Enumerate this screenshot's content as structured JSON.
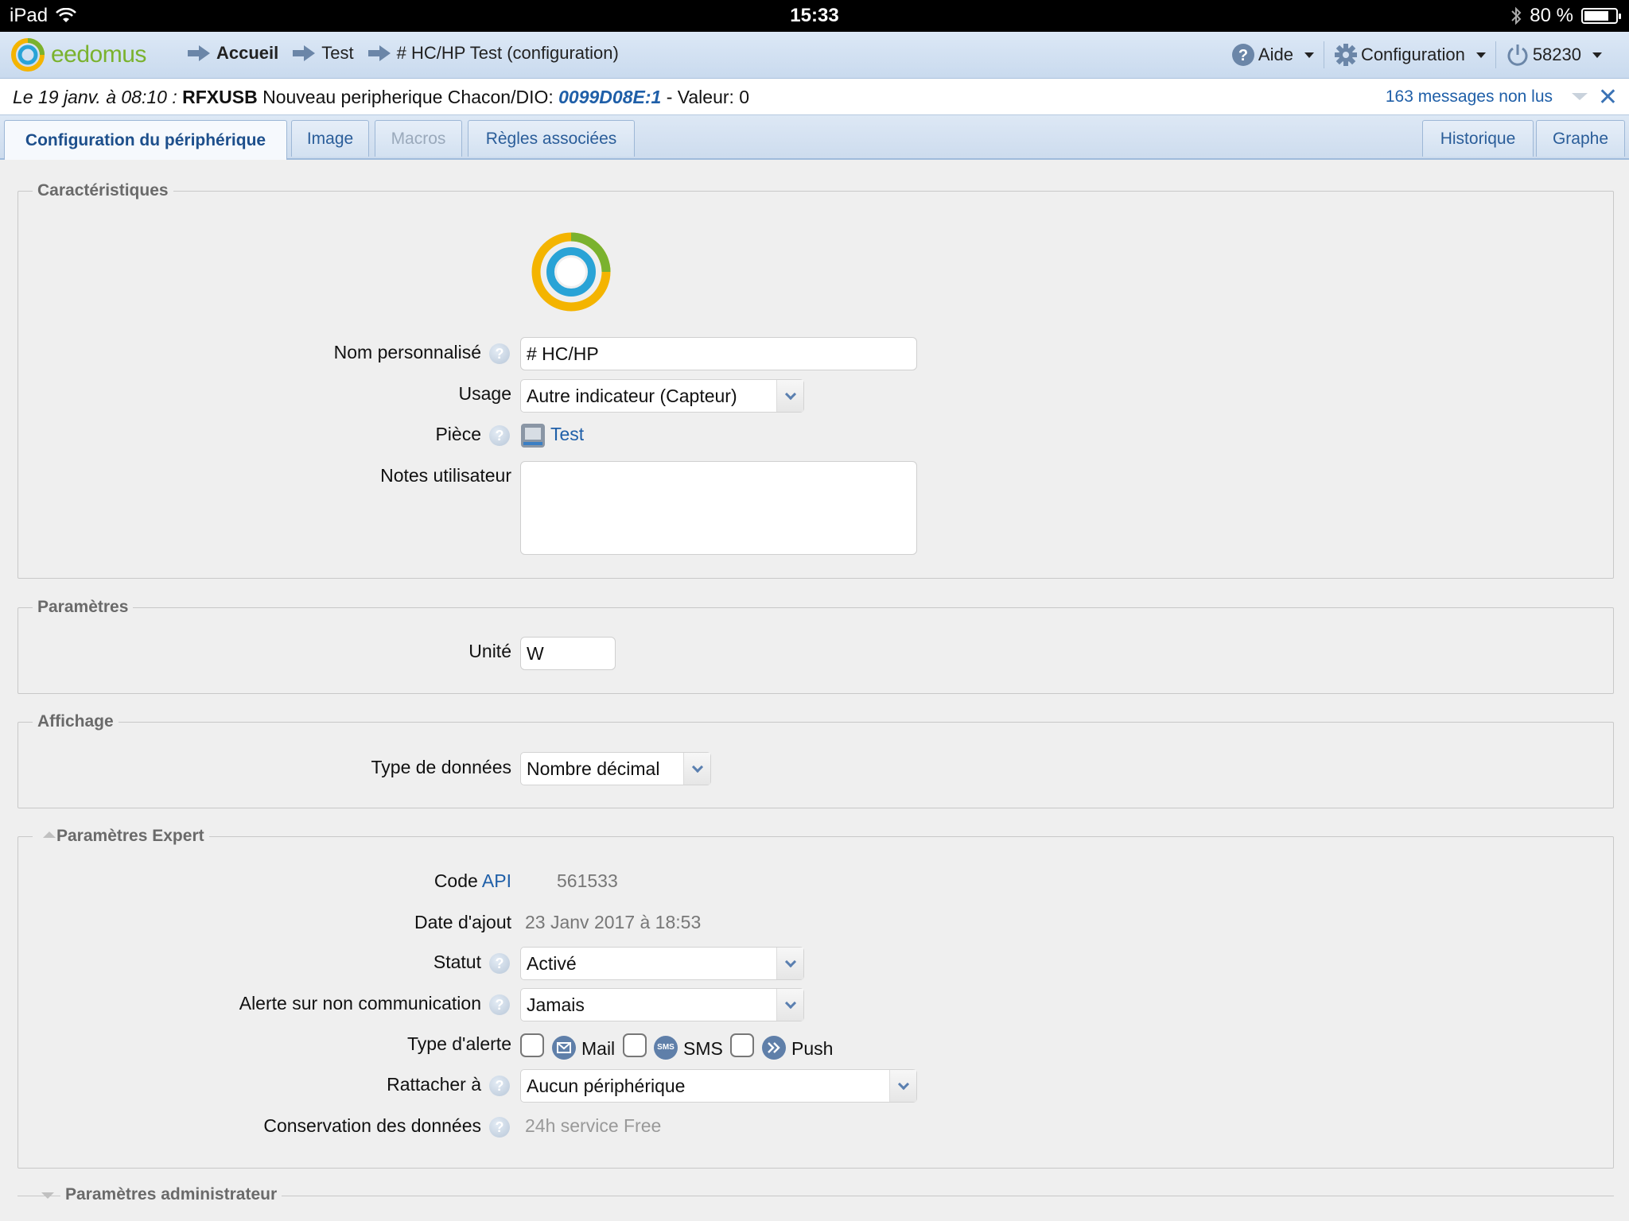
{
  "status_bar": {
    "device": "iPad",
    "time": "15:33",
    "battery": "80 %",
    "battery_level": 0.8
  },
  "header": {
    "logo_text": "eedomus",
    "breadcrumbs": [
      {
        "label": "Accueil"
      },
      {
        "label": "Test"
      },
      {
        "label": "# HC/HP Test (configuration)"
      }
    ],
    "help_label": "Aide",
    "config_label": "Configuration",
    "account_label": "58230"
  },
  "notification": {
    "date": "Le 19 janv. à 08:10 :",
    "device": "RFXUSB",
    "text": "Nouveau peripherique Chacon/DIO:",
    "code": "0099D08E:1",
    "value_text": "- Valeur: 0",
    "unread": "163 messages non lus",
    "close_label": "✕"
  },
  "tabs": {
    "config": "Configuration du périphérique",
    "image": "Image",
    "macros": "Macros",
    "rules": "Règles associées",
    "history": "Historique",
    "graph": "Graphe"
  },
  "characteristics": {
    "title": "Caractéristiques",
    "name_label": "Nom personnalisé",
    "name_value": "# HC/HP",
    "usage_label": "Usage",
    "usage_value": "Autre indicateur (Capteur)",
    "room_label": "Pièce",
    "room_value": "Test",
    "notes_label": "Notes utilisateur",
    "notes_value": ""
  },
  "parameters": {
    "title": "Paramètres",
    "unit_label": "Unité",
    "unit_value": "W"
  },
  "display": {
    "title": "Affichage",
    "datatype_label": "Type de données",
    "datatype_value": "Nombre décimal"
  },
  "expert": {
    "title": "Paramètres Expert",
    "code_label": "Code",
    "api_link": "API",
    "code_value": "561533",
    "date_label": "Date d'ajout",
    "date_value": "23 Janv 2017 à 18:53",
    "status_label": "Statut",
    "status_value": "Activé",
    "nocomm_label": "Alerte sur non communication",
    "nocomm_value": "Jamais",
    "alert_type_label": "Type d'alerte",
    "alert_mail": "Mail",
    "alert_sms": "SMS",
    "alert_sms_icon": "SMS",
    "alert_push": "Push",
    "attach_label": "Rattacher à",
    "attach_value": "Aucun périphérique",
    "retention_label": "Conservation des données",
    "retention_value": "24h service Free"
  },
  "admin": {
    "title": "Paramètres administrateur"
  },
  "colors": {
    "accent": "#1f5fa8",
    "logo_green": "#7ab22e",
    "logo_yellow": "#f4b400",
    "logo_blue": "#29a3d6"
  },
  "icons": [
    "wifi-icon",
    "bluetooth-icon",
    "battery-icon",
    "arrow-right-icon",
    "help-icon",
    "gear-icon",
    "power-icon",
    "close-icon",
    "chevron-down-icon",
    "mail-icon",
    "sms-icon",
    "push-icon",
    "room-icon"
  ]
}
